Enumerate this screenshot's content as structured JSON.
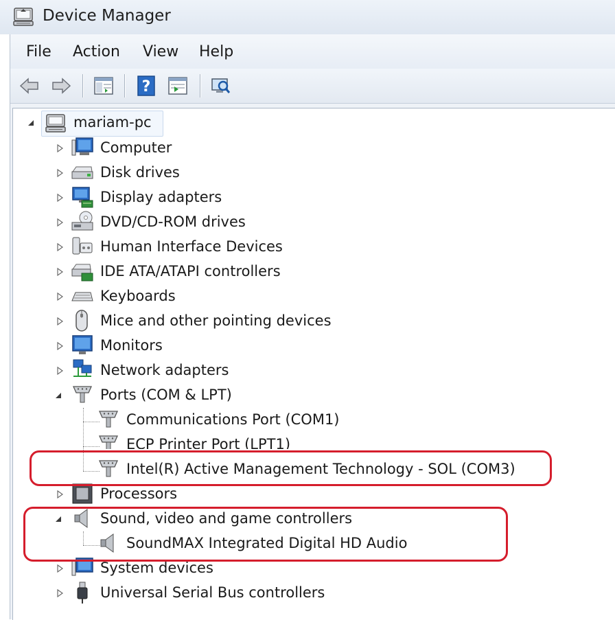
{
  "window": {
    "title": "Device Manager"
  },
  "menu": [
    "File",
    "Action",
    "View",
    "Help"
  ],
  "toolbar": {
    "buttons": [
      "back-arrow-icon",
      "forward-arrow-icon",
      "show-hide-console-tree-icon",
      "help-icon",
      "properties-icon",
      "scan-hardware-icon"
    ]
  },
  "tree": {
    "root": "mariam-pc",
    "categories": [
      {
        "label": "Computer",
        "icon": "computer-icon",
        "expanded": false
      },
      {
        "label": "Disk drives",
        "icon": "disk-drive-icon",
        "expanded": false
      },
      {
        "label": "Display adapters",
        "icon": "display-adapter-icon",
        "expanded": false
      },
      {
        "label": "DVD/CD-ROM drives",
        "icon": "dvd-drive-icon",
        "expanded": false
      },
      {
        "label": "Human Interface Devices",
        "icon": "hid-icon",
        "expanded": false
      },
      {
        "label": "IDE ATA/ATAPI controllers",
        "icon": "ide-controller-icon",
        "expanded": false
      },
      {
        "label": "Keyboards",
        "icon": "keyboard-icon",
        "expanded": false
      },
      {
        "label": "Mice and other pointing devices",
        "icon": "mouse-icon",
        "expanded": false
      },
      {
        "label": "Monitors",
        "icon": "monitor-icon",
        "expanded": false
      },
      {
        "label": "Network adapters",
        "icon": "network-adapter-icon",
        "expanded": false
      },
      {
        "label": "Ports (COM & LPT)",
        "icon": "port-icon",
        "expanded": true,
        "children": [
          "Communications Port (COM1)",
          "ECP Printer Port (LPT1)",
          "Intel(R) Active Management Technology - SOL (COM3)"
        ]
      },
      {
        "label": "Processors",
        "icon": "processor-icon",
        "expanded": false
      },
      {
        "label": "Sound, video and game controllers",
        "icon": "speaker-icon",
        "expanded": true,
        "children": [
          "SoundMAX Integrated Digital HD Audio"
        ]
      },
      {
        "label": "System devices",
        "icon": "system-device-icon",
        "expanded": false
      },
      {
        "label": "Universal Serial Bus controllers",
        "icon": "usb-icon",
        "expanded": false
      }
    ]
  },
  "colors": {
    "highlight_outline": "#d51d2c",
    "accent": "#2b6cc4"
  }
}
